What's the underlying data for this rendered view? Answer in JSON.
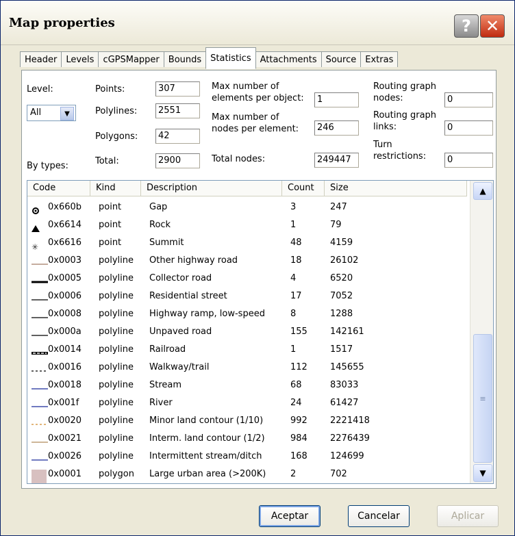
{
  "window": {
    "title": "Map properties"
  },
  "tabs": [
    {
      "label": "Header"
    },
    {
      "label": "Levels"
    },
    {
      "label": "cGPSMapper"
    },
    {
      "label": "Bounds"
    },
    {
      "label": "Statistics"
    },
    {
      "label": "Attachments"
    },
    {
      "label": "Source"
    },
    {
      "label": "Extras"
    }
  ],
  "stats": {
    "level_label": "Level:",
    "level_value": "All",
    "points_label": "Points:",
    "points_value": "307",
    "polylines_label": "Polylines:",
    "polylines_value": "2551",
    "polygons_label": "Polygons:",
    "polygons_value": "42",
    "total_label": "Total:",
    "total_value": "2900",
    "max_per_object_label_1": "Max number of",
    "max_per_object_label_2": "elements per object:",
    "max_per_object_value": "1",
    "max_per_element_label_1": "Max number of",
    "max_per_element_label_2": "nodes per element:",
    "max_per_element_value": "246",
    "total_nodes_label": "Total nodes:",
    "total_nodes_value": "249447",
    "routing_nodes_label_1": "Routing graph",
    "routing_nodes_label_2": "nodes:",
    "routing_nodes_value": "0",
    "routing_links_label_1": "Routing graph",
    "routing_links_label_2": "links:",
    "routing_links_value": "0",
    "turn_label_1": "Turn",
    "turn_label_2": "restrictions:",
    "turn_value": "0",
    "by_types_label": "By types:"
  },
  "table": {
    "headers": [
      "Code",
      "Kind",
      "Description",
      "Count",
      "Size"
    ],
    "rows": [
      {
        "symbol": "target-icon",
        "code": "0x660b",
        "kind": "point",
        "description": "Gap",
        "count": "3",
        "size": "247"
      },
      {
        "symbol": "mountain-icon",
        "code": "0x6614",
        "kind": "point",
        "description": "Rock",
        "count": "1",
        "size": "79"
      },
      {
        "symbol": "star-icon",
        "code": "0x6616",
        "kind": "point",
        "description": "Summit",
        "count": "48",
        "size": "4159"
      },
      {
        "symbol": "line-brown",
        "code": "0x0003",
        "kind": "polyline",
        "description": "Other highway road",
        "count": "18",
        "size": "26102"
      },
      {
        "symbol": "line-thick-black",
        "code": "0x0005",
        "kind": "polyline",
        "description": "Collector road",
        "count": "4",
        "size": "6520"
      },
      {
        "symbol": "line-black",
        "code": "0x0006",
        "kind": "polyline",
        "description": "Residential street",
        "count": "17",
        "size": "7052"
      },
      {
        "symbol": "line-black",
        "code": "0x0008",
        "kind": "polyline",
        "description": "Highway ramp, low-speed",
        "count": "8",
        "size": "1288"
      },
      {
        "symbol": "line-black",
        "code": "0x000a",
        "kind": "polyline",
        "description": "Unpaved road",
        "count": "155",
        "size": "142161"
      },
      {
        "symbol": "line-rail",
        "code": "0x0014",
        "kind": "polyline",
        "description": "Railroad",
        "count": "1",
        "size": "1517"
      },
      {
        "symbol": "line-dashed-black",
        "code": "0x0016",
        "kind": "polyline",
        "description": "Walkway/trail",
        "count": "112",
        "size": "145655"
      },
      {
        "symbol": "line-blue",
        "code": "0x0018",
        "kind": "polyline",
        "description": "Stream",
        "count": "68",
        "size": "83033"
      },
      {
        "symbol": "line-blue",
        "code": "0x001f",
        "kind": "polyline",
        "description": "River",
        "count": "24",
        "size": "61427"
      },
      {
        "symbol": "line-dashed-orange",
        "code": "0x0020",
        "kind": "polyline",
        "description": "Minor land contour (1/10)",
        "count": "992",
        "size": "2221418"
      },
      {
        "symbol": "line-tan",
        "code": "0x0021",
        "kind": "polyline",
        "description": "Interm. land contour (1/2)",
        "count": "984",
        "size": "2276439"
      },
      {
        "symbol": "line-blue",
        "code": "0x0026",
        "kind": "polyline",
        "description": "Intermittent stream/ditch",
        "count": "168",
        "size": "124699"
      },
      {
        "symbol": "area-pink",
        "code": "0x0001",
        "kind": "polygon",
        "description": "Large urban area (>200K)",
        "count": "2",
        "size": "702"
      }
    ]
  },
  "buttons": {
    "accept": "Aceptar",
    "cancel": "Cancelar",
    "apply": "Aplicar"
  },
  "colors": {
    "brown": "#8b5a3c",
    "blue": "#1a2a9a",
    "orange": "#d08a2a",
    "tan": "#b08a5a",
    "pink": "#d8c0c0"
  }
}
